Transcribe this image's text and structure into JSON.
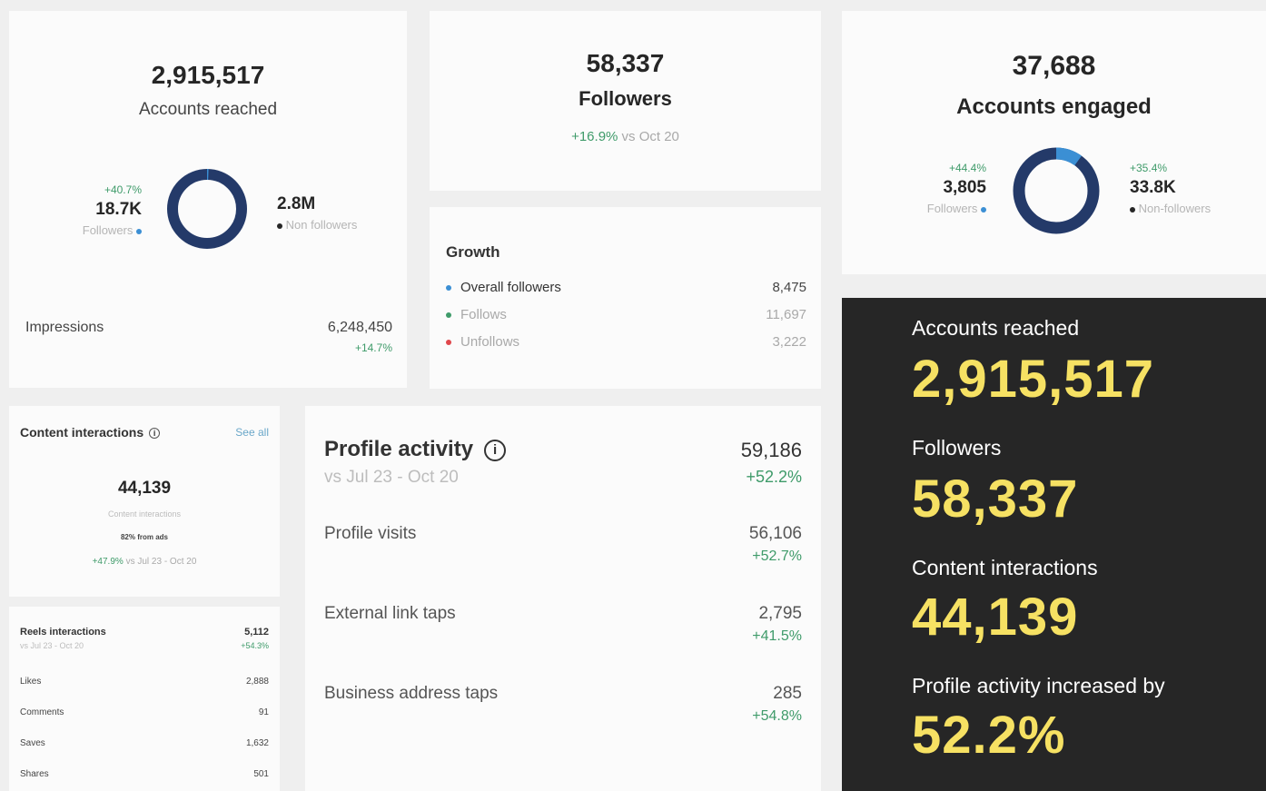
{
  "accounts_reached": {
    "value": "2,915,517",
    "label": "Accounts reached",
    "followers": {
      "change": "+40.7%",
      "value": "18.7K",
      "label": "Followers"
    },
    "non_followers": {
      "value": "2.8M",
      "label": "Non followers"
    },
    "followers_share": 0.006,
    "impressions": {
      "label": "Impressions",
      "value": "6,248,450",
      "change": "+14.7%"
    }
  },
  "followers_card": {
    "value": "58,337",
    "label": "Followers",
    "change": "+16.9%",
    "comparison": "vs Oct 20"
  },
  "growth": {
    "title": "Growth",
    "rows": [
      {
        "label": "Overall followers",
        "value": "8,475",
        "color": "#3b8fd4"
      },
      {
        "label": "Follows",
        "value": "11,697",
        "color": "#3f9b6a"
      },
      {
        "label": "Unfollows",
        "value": "3,222",
        "color": "#e0474c"
      }
    ]
  },
  "accounts_engaged": {
    "value": "37,688",
    "label": "Accounts engaged",
    "followers": {
      "change": "+44.4%",
      "value": "3,805",
      "label": "Followers"
    },
    "non_followers": {
      "change": "+35.4%",
      "value": "33.8K",
      "label": "Non-followers"
    },
    "followers_share": 0.1
  },
  "content_interactions": {
    "title": "Content interactions",
    "see_all": "See all",
    "value": "44,139",
    "label": "Content interactions",
    "ads_note": "82% from ads",
    "change": "+47.9%",
    "comparison": "vs Jul 23 - Oct 20"
  },
  "reels_interactions": {
    "title": "Reels interactions",
    "period": "vs Jul 23 - Oct 20",
    "total": "5,112",
    "change": "+54.3%",
    "rows": [
      {
        "label": "Likes",
        "value": "2,888"
      },
      {
        "label": "Comments",
        "value": "91"
      },
      {
        "label": "Saves",
        "value": "1,632"
      },
      {
        "label": "Shares",
        "value": "501"
      }
    ]
  },
  "profile_activity": {
    "title": "Profile activity",
    "info_icon": "i",
    "period": "vs Jul 23 - Oct 20",
    "total": "59,186",
    "change": "+52.2%",
    "rows": [
      {
        "label": "Profile visits",
        "value": "56,106",
        "change": "+52.7%"
      },
      {
        "label": "External link taps",
        "value": "2,795",
        "change": "+41.5%"
      },
      {
        "label": "Business address taps",
        "value": "285",
        "change": "+54.8%"
      }
    ]
  },
  "summary": {
    "items": [
      {
        "label": "Accounts reached",
        "value": "2,915,517"
      },
      {
        "label": "Followers",
        "value": "58,337"
      },
      {
        "label": "Content interactions",
        "value": "44,139"
      },
      {
        "label": "Profile activity increased by",
        "value": "52.2%"
      }
    ]
  },
  "colors": {
    "donut_main": "#243a69",
    "donut_accent": "#3b8fd4",
    "positive": "#3f9b6a",
    "highlight": "#f6e163",
    "dark_panel": "#262626"
  }
}
